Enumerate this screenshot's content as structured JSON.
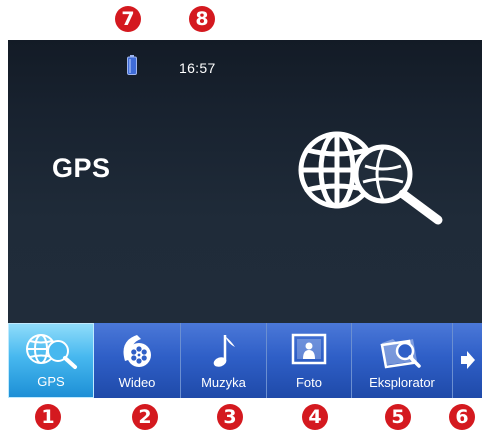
{
  "status": {
    "time": "16:57"
  },
  "app": {
    "title": "GPS"
  },
  "nav": {
    "items": [
      {
        "label": "GPS",
        "icon": "globe-search-icon"
      },
      {
        "label": "Wideo",
        "icon": "film-reel-icon"
      },
      {
        "label": "Muzyka",
        "icon": "music-note-icon"
      },
      {
        "label": "Foto",
        "icon": "photo-frame-icon"
      },
      {
        "label": "Eksplorator",
        "icon": "folder-search-icon"
      }
    ],
    "next_icon": "arrow-right-icon"
  },
  "markers": [
    "1",
    "2",
    "3",
    "4",
    "5",
    "6",
    "7",
    "8"
  ],
  "colors": {
    "marker": "#d4191f",
    "screen_bg": "#1f2b39",
    "nav_bg": "#2f5fc7",
    "nav_active": "#47b8ef",
    "battery": "#3f6cd8"
  }
}
